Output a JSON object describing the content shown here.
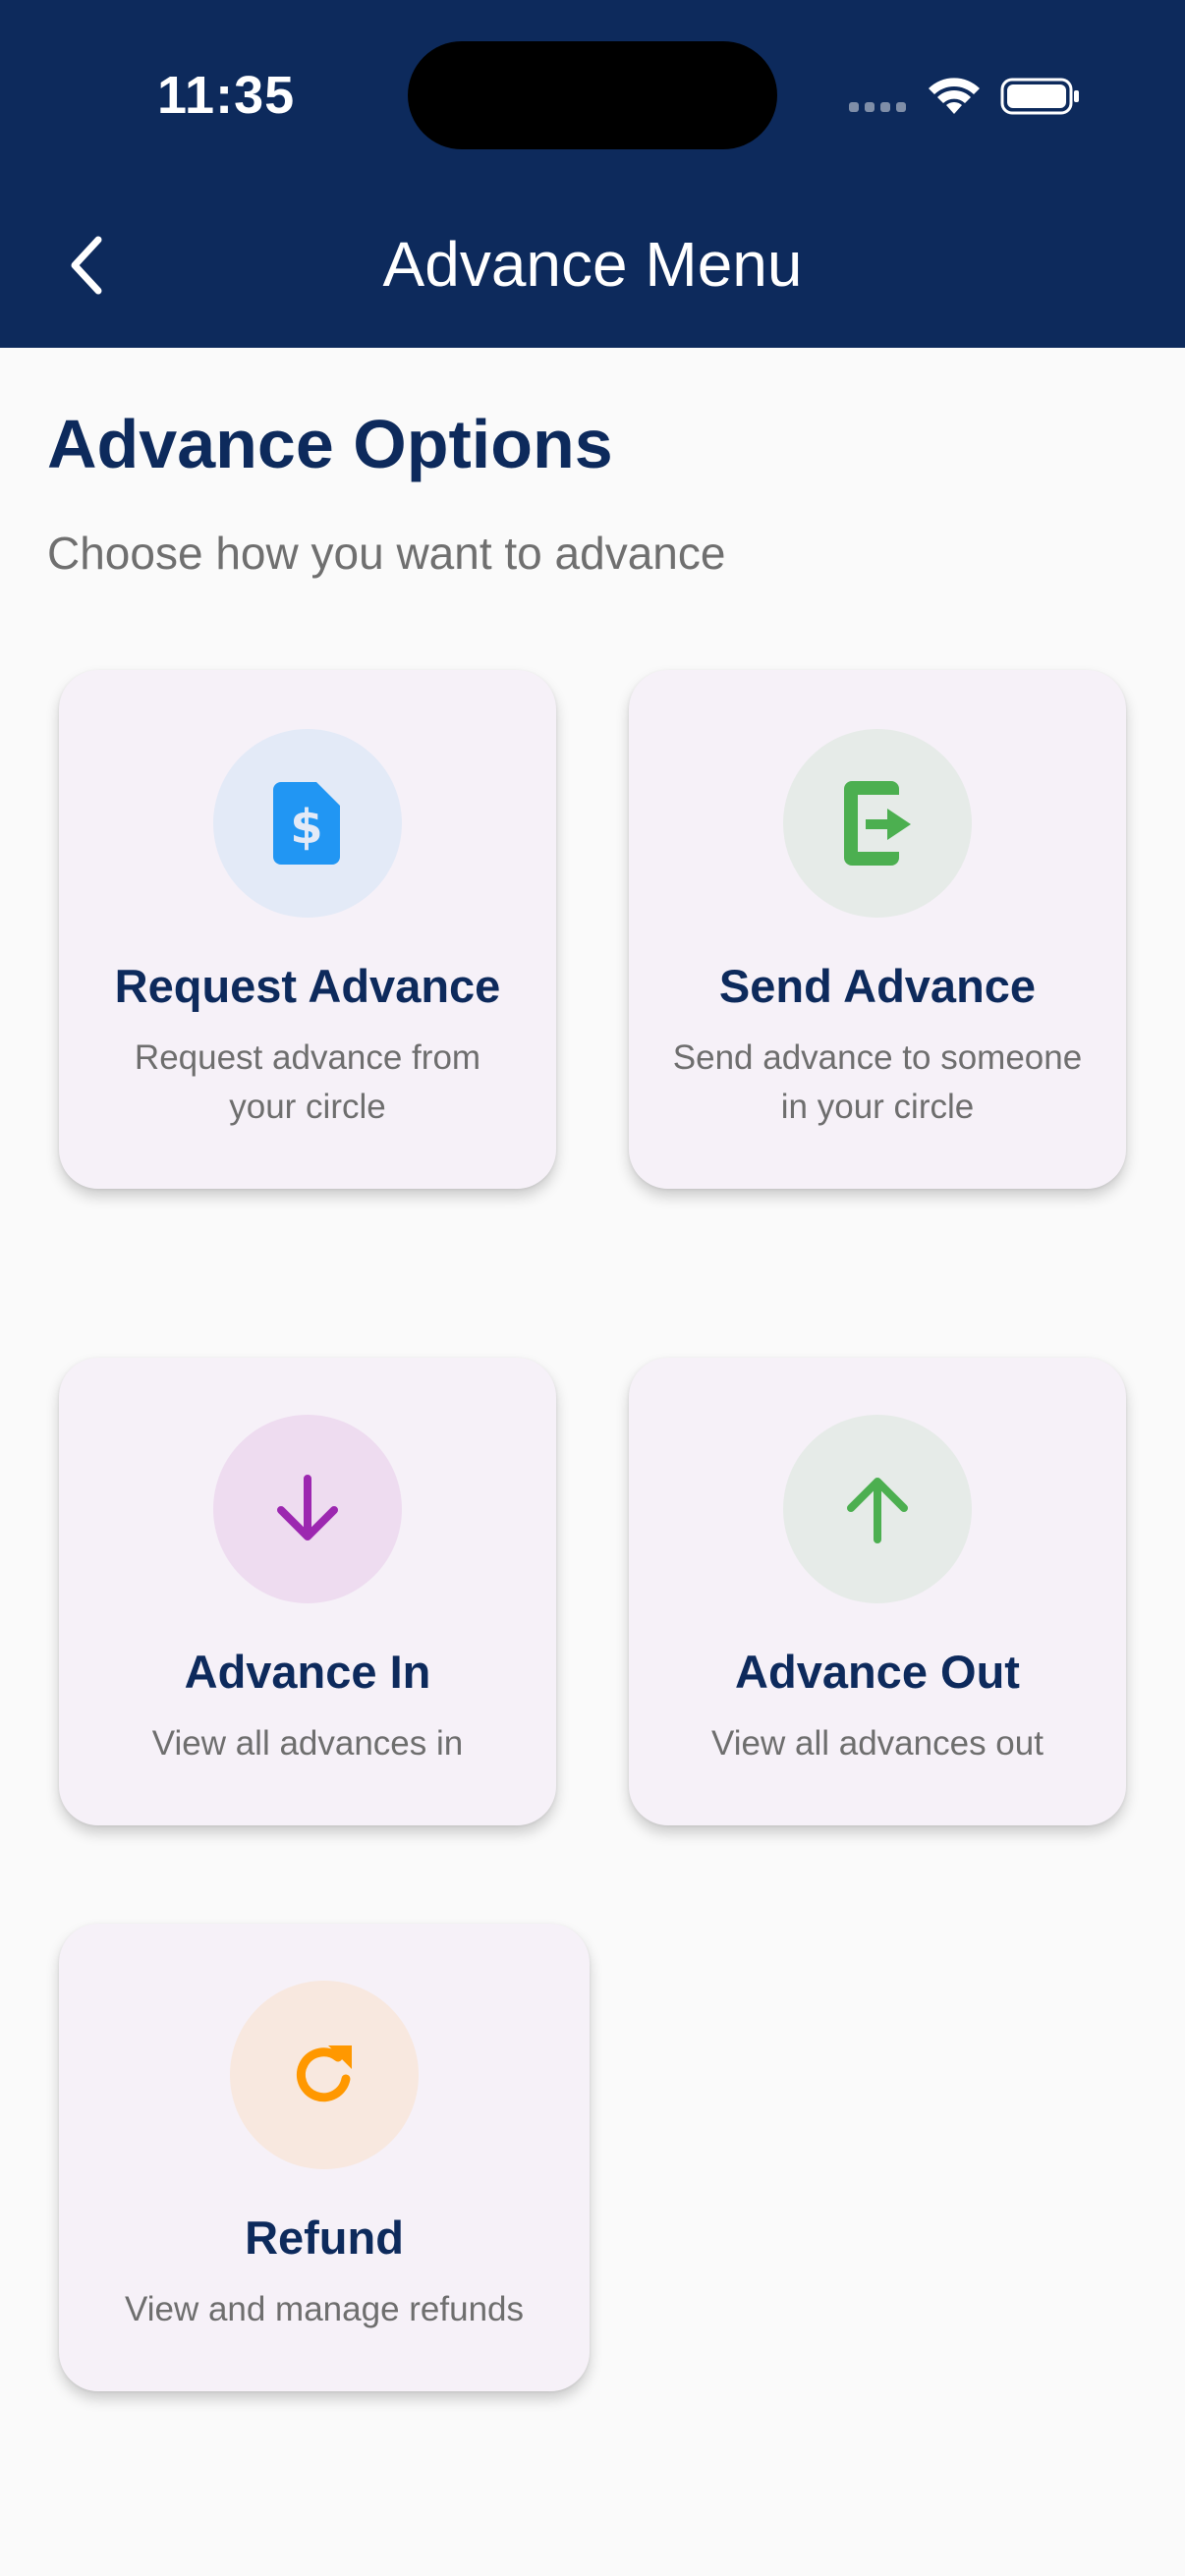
{
  "status_bar": {
    "time": "11:35"
  },
  "header": {
    "title": "Advance Menu",
    "back_icon": "chevron-left-icon"
  },
  "main": {
    "title": "Advance Options",
    "subtitle": "Choose how you want to advance"
  },
  "cards": [
    {
      "title": "Request Advance",
      "description": "Request advance from your circle",
      "icon": "dollar-document-icon",
      "icon_color": "#2196f3",
      "circle_color": "#e3eaf7"
    },
    {
      "title": "Send Advance",
      "description": "Send advance to someone in your circle",
      "icon": "phone-send-icon",
      "icon_color": "#4caf50",
      "circle_color": "#e6ebe8"
    },
    {
      "title": "Advance In",
      "description": "View all advances in",
      "icon": "arrow-down-icon",
      "icon_color": "#9c27b0",
      "circle_color": "#eedcf0"
    },
    {
      "title": "Advance Out",
      "description": "View all advances out",
      "icon": "arrow-up-icon",
      "icon_color": "#4caf50",
      "circle_color": "#e6ebe8"
    },
    {
      "title": "Refund",
      "description": "View and manage refunds",
      "icon": "refresh-icon",
      "icon_color": "#ff9800",
      "circle_color": "#f8e8df"
    }
  ]
}
